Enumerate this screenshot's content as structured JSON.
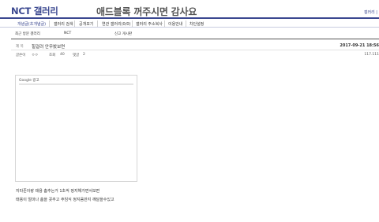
{
  "header": {
    "gallery_title": "NCT 갤러리",
    "banner_text": "애드블록 꺼주시면 감사요",
    "top_right_link": "갤러리 |"
  },
  "topnav": {
    "items": [
      "개념글(초개념글)",
      "갤러리 검색",
      "공개모기",
      "연관 갤러리(0/0)",
      "갤러리 주소복사",
      "이용안내",
      "차단설정"
    ]
  },
  "subnav": {
    "items": [
      "최근 방문 갤러리",
      "NCT",
      "신고 게시판"
    ]
  },
  "post": {
    "subject_label": "제 목",
    "subject": "힐걸려 안무봤보면",
    "date": "2017-09-21 18:56",
    "author_label": "글쓴이",
    "author": "ㅇㅇ",
    "views_label": "조회",
    "views": "40",
    "comments_label": "댓글",
    "comments": "2",
    "ip": "117.111"
  },
  "ad": {
    "label": "Google 광고"
  },
  "body": {
    "lines": [
      "지타존이랑 태용 춤추는거 1초씩 정지해가면서보면",
      "태용이 얼마나 춤을 꼿추고 주임식 정지음만지 꺠달을수있고"
    ]
  }
}
